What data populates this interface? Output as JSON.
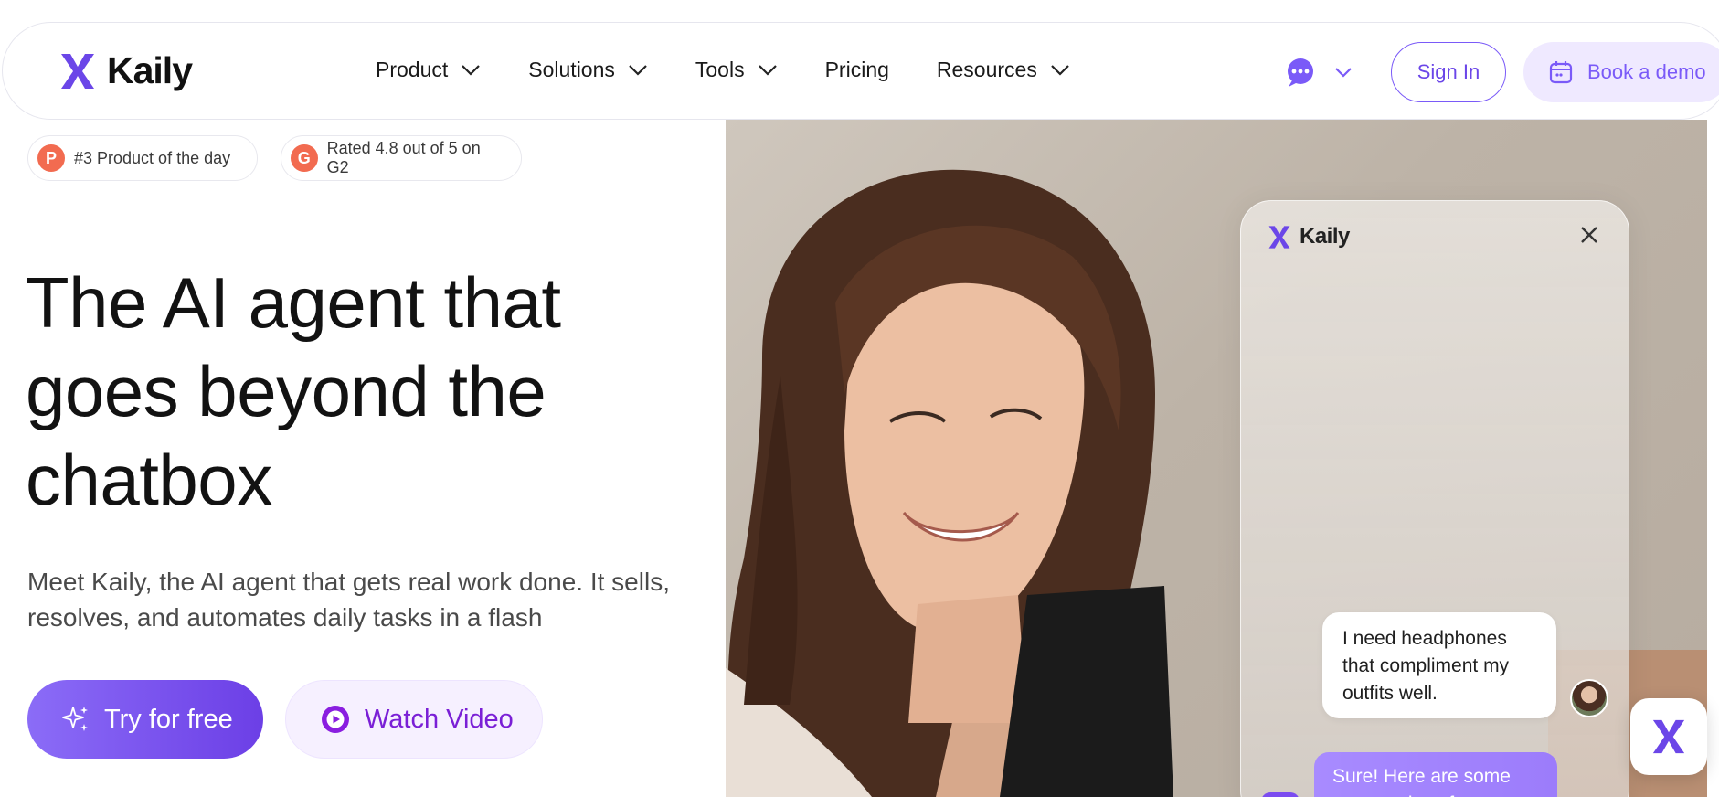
{
  "brand": {
    "name": "Kaily",
    "color": "#6b46e8"
  },
  "nav": {
    "items": [
      {
        "label": "Product",
        "has_dropdown": true
      },
      {
        "label": "Solutions",
        "has_dropdown": true
      },
      {
        "label": "Tools",
        "has_dropdown": true
      },
      {
        "label": "Pricing",
        "has_dropdown": false
      },
      {
        "label": "Resources",
        "has_dropdown": true
      }
    ],
    "language_icon": "chat-bubble-icon",
    "sign_in_label": "Sign In",
    "book_demo_label": "Book a demo"
  },
  "badges": [
    {
      "icon": "P",
      "text": "#3 Product of the day"
    },
    {
      "icon": "G",
      "text": "Rated 4.8 out of 5 on G2"
    }
  ],
  "hero": {
    "title_line1": "The AI agent that",
    "title_line2": "goes beyond the",
    "title_line3": "chatbox",
    "subtitle_line1": "Meet Kaily, the AI agent that gets real work done. It sells,",
    "subtitle_line2": "resolves, and automates daily tasks in a flash",
    "try_label": "Try for free",
    "watch_label": "Watch Video"
  },
  "chat_widget": {
    "title": "Kaily",
    "user_message": "I need headphones that compliment my outfits well.",
    "bot_message": "Sure! Here are some great options for you..."
  },
  "colors": {
    "accent": "#7a5af8",
    "accent_dark": "#6c3fe6",
    "watch_text": "#7a1fd6",
    "badge_dot": "#f26b50"
  }
}
